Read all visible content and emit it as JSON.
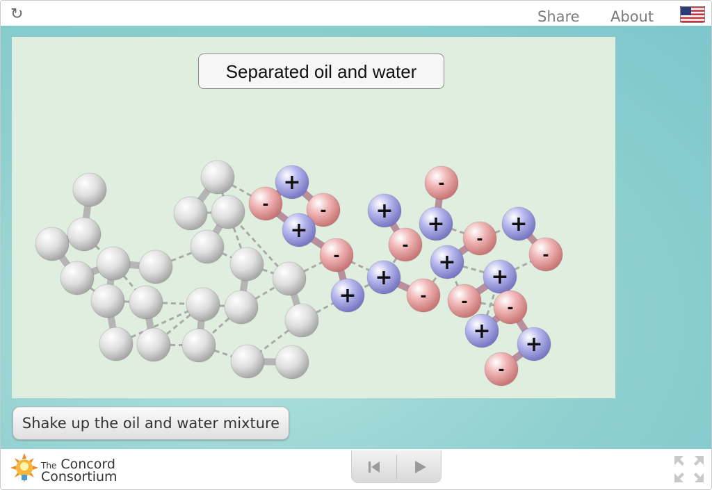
{
  "topbar": {
    "reload_icon": "reload-icon",
    "share_label": "Share",
    "about_label": "About",
    "language_flag": "us-flag-icon"
  },
  "model": {
    "title": "Separated oil and water",
    "colors": {
      "background": "#e0eedf",
      "oil_atom": "#d9d9d9",
      "positive_atom": "#9c9ce0",
      "negative_atom": "#e39b9b",
      "bond": "#b5b5b5",
      "hydrogen_bond": "#a9a9a9"
    },
    "charges": {
      "positive": "+",
      "negative": "-"
    }
  },
  "controls": {
    "shake_label": "Shake up the oil and water mixture"
  },
  "footer": {
    "logo_line1_small": "The",
    "logo_line1": "Concord",
    "logo_line2": "Consortium",
    "reset_icon": "skip-back-icon",
    "play_icon": "play-icon",
    "fullscreen_icon": "fullscreen-icon"
  }
}
